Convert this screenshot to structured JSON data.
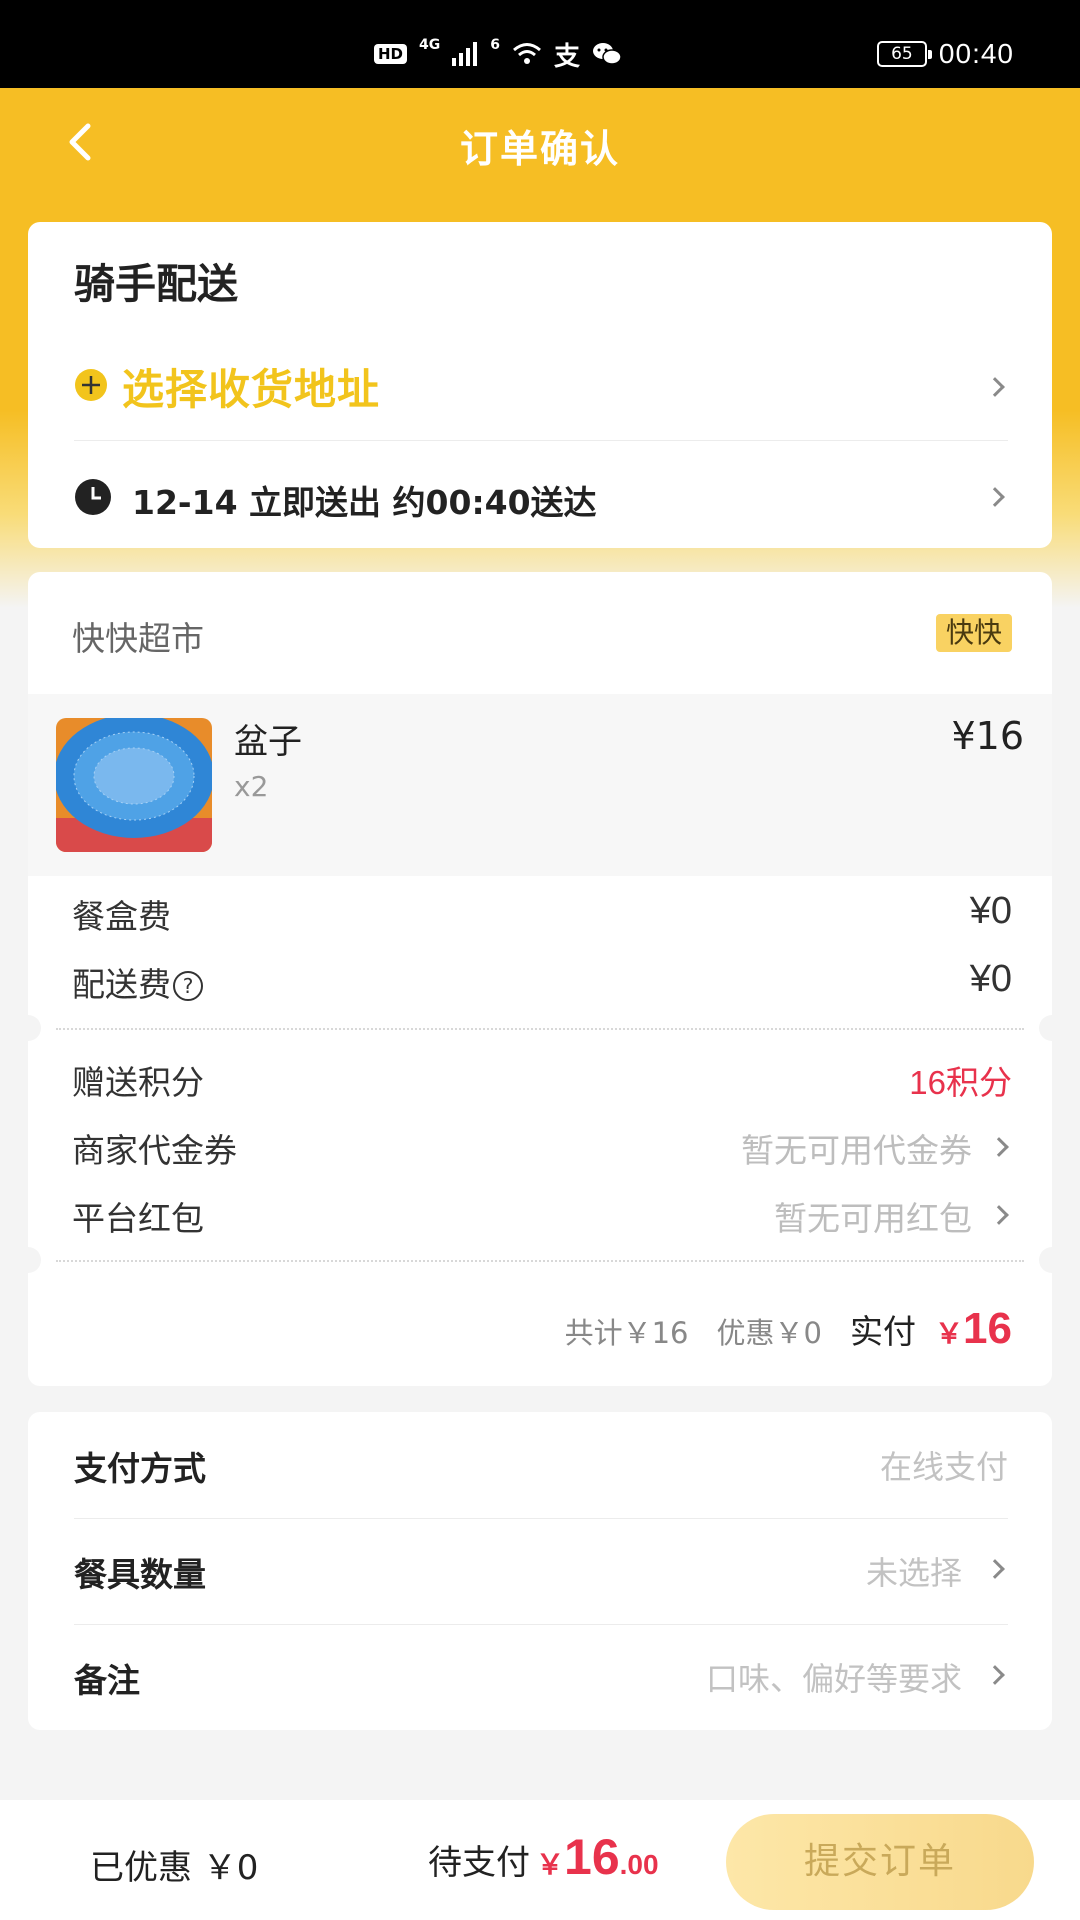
{
  "status_bar": {
    "hd": "HD",
    "net1": "4G",
    "net2": "6",
    "alipay_glyph": "支",
    "battery": "65",
    "time": "00:40",
    "icons": [
      "signal-icon",
      "wifi-icon",
      "alipay-icon",
      "wechat-icon"
    ]
  },
  "nav": {
    "title": "订单确认",
    "back_icon": "back-arrow-icon"
  },
  "delivery": {
    "title": "骑手配送",
    "address_label": "选择收货地址",
    "time_label": "12-14 立即送出 约00:40送达",
    "accent": "#f2c41c"
  },
  "order": {
    "shop_name": "快快超市",
    "shop_badge": "快快",
    "item": {
      "name": "盆子",
      "qty": "x2",
      "price": "¥16"
    },
    "box_fee_label": "餐盒费",
    "box_fee_value": "¥0",
    "delivery_fee_label": "配送费",
    "delivery_fee_value": "¥0",
    "points_label": "赠送积分",
    "points_value": "16积分",
    "voucher_label": "商家代金券",
    "voucher_value": "暂无可用代金券",
    "redpacket_label": "平台红包",
    "redpacket_value": "暂无可用红包",
    "total_text": "共计￥16",
    "discount_text": "优惠￥0",
    "pay_label": "实付",
    "pay_currency": "￥",
    "pay_amount": "16"
  },
  "payment": {
    "method_label": "支付方式",
    "method_value": "在线支付",
    "utensils_label": "餐具数量",
    "utensils_value": "未选择",
    "remark_label": "备注",
    "remark_placeholder": "口味、偏好等要求"
  },
  "bottom": {
    "discount_text": "已优惠 ￥0",
    "pending_label": "待支付",
    "currency": "￥",
    "amount_int": "16",
    "amount_dec": ".00",
    "submit_label": "提交订单"
  },
  "colors": {
    "brand_yellow": "#f6be24",
    "price_red": "#e8324c",
    "submit_bg": "#fde7a8"
  }
}
